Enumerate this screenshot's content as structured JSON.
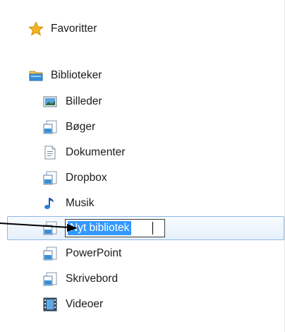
{
  "nav": {
    "favorites_label": "Favoritter",
    "libraries_label": "Biblioteker",
    "items": [
      {
        "label": "Billeder",
        "icon": "pictures-library-icon"
      },
      {
        "label": "Bøger",
        "icon": "library-icon"
      },
      {
        "label": "Dokumenter",
        "icon": "documents-library-icon"
      },
      {
        "label": "Dropbox",
        "icon": "library-icon"
      },
      {
        "label": "Musik",
        "icon": "music-library-icon"
      }
    ],
    "rename_value": "Nyt bibliotek",
    "items_after": [
      {
        "label": "PowerPoint",
        "icon": "library-icon"
      },
      {
        "label": "Skrivebord",
        "icon": "library-icon"
      },
      {
        "label": "Videoer",
        "icon": "videos-library-icon"
      }
    ]
  },
  "colors": {
    "selection_fill": "#e6f0fb",
    "selection_border": "#8fb8e6",
    "text_highlight": "#3399ff",
    "star": "#f5b220",
    "folder": "#3a8fd8"
  }
}
